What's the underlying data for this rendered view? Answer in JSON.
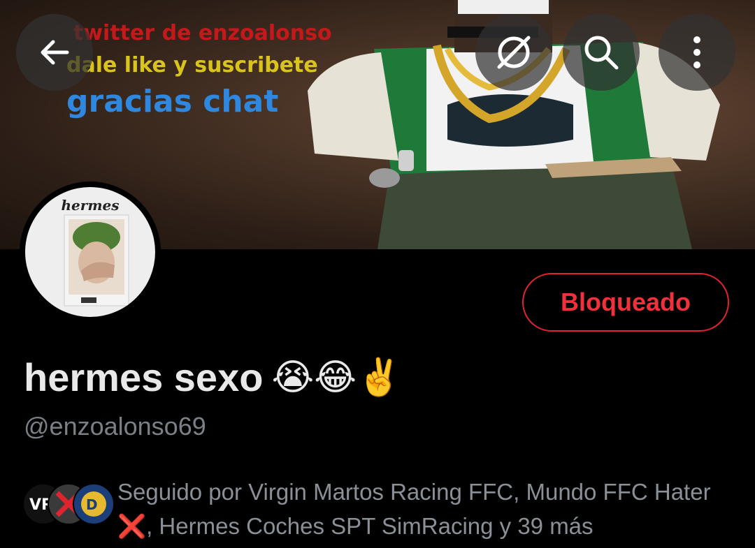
{
  "banner": {
    "line1": "twitter de enzoalonso",
    "line2": "dale like y suscribete",
    "line3": "gracias chat"
  },
  "toolbar": {
    "back_icon": "arrow-left-icon",
    "grok_icon": "grok-icon",
    "search_icon": "search-icon",
    "more_icon": "more-vertical-icon"
  },
  "avatar": {
    "title": "hermes"
  },
  "profile": {
    "blocked_label": "Bloqueado",
    "display_name": "hermes sexo",
    "name_emojis": "😭😂✌️",
    "handle": "@enzoalonso69"
  },
  "followers": {
    "text_before": "Seguido por Virgin Martos Racing FFC, Mundo FFC Hater ",
    "cross_emoji": "❌",
    "text_after": ", Hermes Coches SPT SimRacing y 39 más"
  },
  "colors": {
    "accent_red": "#e0242f",
    "background": "#000000",
    "secondary_text": "#7b8086"
  }
}
